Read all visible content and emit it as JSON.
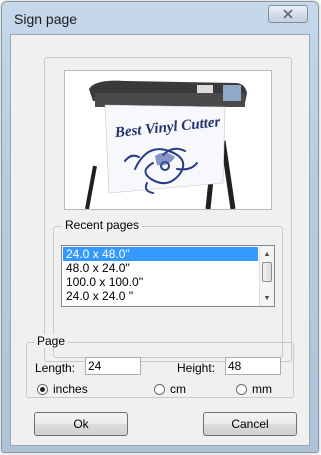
{
  "window": {
    "title": "Sign page"
  },
  "preview": {
    "banner_text": "Best Vinyl Cutter"
  },
  "recent_pages": {
    "label": "Recent pages",
    "items": [
      "24.0 x 48.0''",
      "48.0 x 24.0''",
      "100.0 x 100.0''",
      "24.0 x 24.0 ''"
    ],
    "selected_index": 0
  },
  "page": {
    "label": "Page",
    "length_label": "Length:",
    "length_value": "24",
    "height_label": "Height:",
    "height_value": "48",
    "units": [
      {
        "label": "inches",
        "checked": true
      },
      {
        "label": "cm",
        "checked": false
      },
      {
        "label": "mm",
        "checked": false
      }
    ]
  },
  "buttons": {
    "ok": "Ok",
    "cancel": "Cancel"
  },
  "colors": {
    "selection": "#3399ff",
    "title_bar": "#b7cbe0"
  }
}
